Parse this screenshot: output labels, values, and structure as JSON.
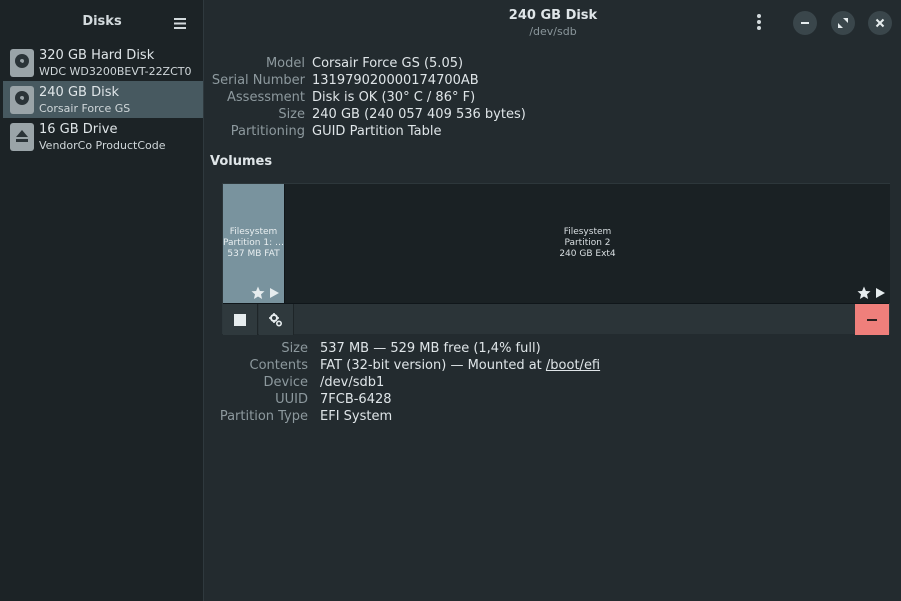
{
  "sidebar": {
    "title": "Disks",
    "disks": [
      {
        "name": "320 GB Hard Disk",
        "sub": "WDC WD3200BEVT-22ZCT0"
      },
      {
        "name": "240 GB Disk",
        "sub": "Corsair Force GS"
      },
      {
        "name": "16 GB Drive",
        "sub": "VendorCo ProductCode"
      }
    ]
  },
  "header": {
    "title": "240 GB Disk",
    "subtitle": "/dev/sdb"
  },
  "properties": [
    {
      "label": "Model",
      "value": "Corsair Force GS (5.05)"
    },
    {
      "label": "Serial Number",
      "value": "131979020000174700AB"
    },
    {
      "label": "Assessment",
      "value": "Disk is OK (30° C / 86° F)"
    },
    {
      "label": "Size",
      "value": "240 GB (240 057 409 536 bytes)"
    },
    {
      "label": "Partitioning",
      "value": "GUID Partition Table"
    }
  ],
  "volumes": {
    "title": "Volumes",
    "partitions": [
      {
        "line1": "Filesystem",
        "line2": "Partition 1: …",
        "line3": "537 MB FAT"
      },
      {
        "line1": "Filesystem",
        "line2": "Partition 2",
        "line3": "240 GB Ext4"
      }
    ]
  },
  "details": {
    "size": {
      "label": "Size",
      "value": "537 MB — 529 MB free (1,4% full)"
    },
    "contents": {
      "label": "Contents",
      "value": "FAT (32-bit version) — Mounted at ",
      "link": "/boot/efi"
    },
    "device": {
      "label": "Device",
      "value": "/dev/sdb1"
    },
    "uuid": {
      "label": "UUID",
      "value": "7FCB-6428"
    },
    "partition_type": {
      "label": "Partition Type",
      "value": "EFI System"
    }
  },
  "colors": {
    "selected": "#475960",
    "partition_selected": "#79939e",
    "delete": "#ef7f7b"
  }
}
